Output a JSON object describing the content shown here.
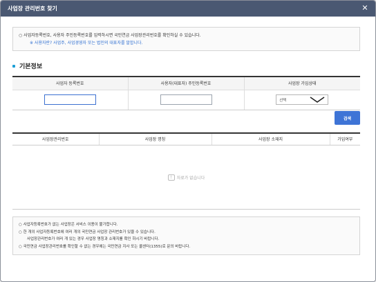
{
  "dialog": {
    "title": "사업장 관리번호 찾기",
    "close_glyph": "✕"
  },
  "notice_top": {
    "bullet": "○",
    "line1": "사업자등록번호, 사용자 주민등록번호를 입력하시면 국민연금 사업장관리번호를 확인하실 수 있습니다.",
    "line2": "※ 사용자란? 사업주, 사업경영자 또는 법인의 대표자를 말합니다."
  },
  "section": {
    "title": "기본정보"
  },
  "form": {
    "headers": [
      "사업자 등록번호",
      "사용자(대표자) 주민등록번호",
      "사업장 가입상태"
    ],
    "business_no_value": "",
    "resident_no_value": "",
    "status_select_value": "선택"
  },
  "search_button": "검색",
  "results": {
    "headers": [
      "사업장관리번호",
      "사업장 명칭",
      "사업장 소재지",
      "가입여부"
    ],
    "empty_message": "자료가 없습니다"
  },
  "notice_bottom": {
    "bullet": "○",
    "line1": "사업자등록번호가 없는 사업장은 서비스 이용이 불가합니다.",
    "line2": "한 개의 사업자등록번호에 여러 개의 국민연금 사업장 관리번호가 있을 수 있습니다.",
    "line3": "사업장관리번호가 여러 개 있는 경우 사업장 명칭과 소재지를 확인 하시기 바랍니다.",
    "line4": "국민연금 사업장관리번호를 확인할 수 없는 경우에는 국민연금 지사 또는 콜센터(1355)로 문의 바랍니다."
  },
  "colors": {
    "titlebar": "#4a5872",
    "accent": "#3e74d6",
    "link": "#2f6fd1"
  },
  "icons": {
    "close": "close-icon",
    "dropdown": "chevron-down-icon",
    "empty": "speech-bubble-icon",
    "section_bullet": "square-bullet-icon"
  }
}
